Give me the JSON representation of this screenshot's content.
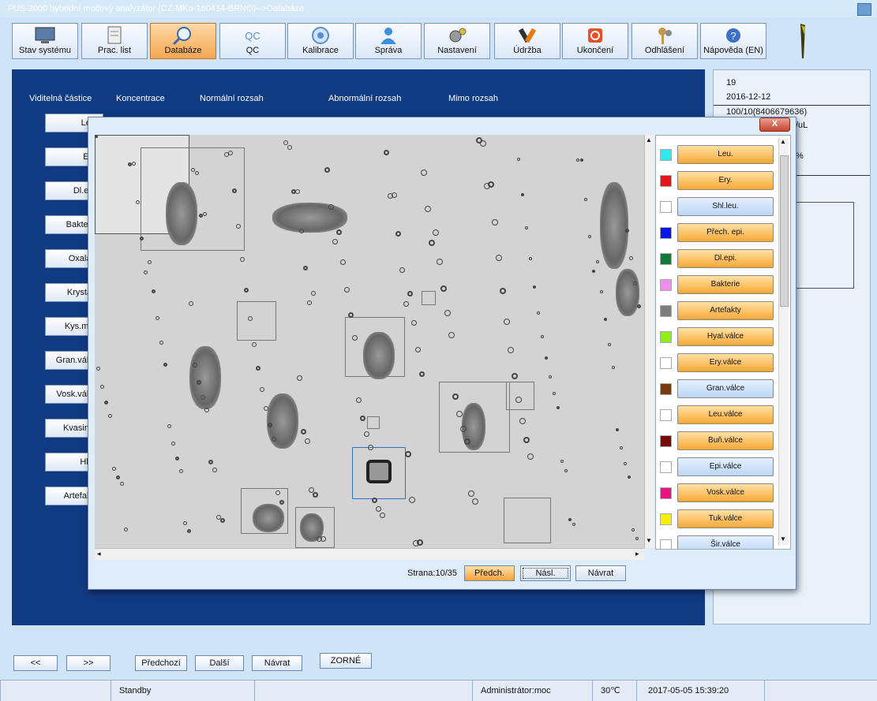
{
  "window": {
    "title": "FUS-2000 hybridní močový analyzátor (CZ-MKo-160414-BRNO)-->Databáze"
  },
  "toolbar": {
    "items": [
      {
        "label": "Stav systému",
        "icon": "monitor-icon"
      },
      {
        "label": "Prac. list",
        "icon": "worklist-icon"
      },
      {
        "label": "Databáze",
        "icon": "magnifier-icon",
        "active": true
      },
      {
        "label": "QC",
        "icon": "qc-icon",
        "icon_text": "QC"
      },
      {
        "label": "Kalibrace",
        "icon": "target-icon"
      },
      {
        "label": "Správa",
        "icon": "user-icon"
      },
      {
        "label": "Nastavení",
        "icon": "gears-icon"
      },
      {
        "label": "Údržba",
        "icon": "tools-icon"
      },
      {
        "label": "Ukončení",
        "icon": "power-icon"
      },
      {
        "label": "Odhlášení",
        "icon": "keys-icon"
      },
      {
        "label": "Nápověda (EN)",
        "icon": "help-icon"
      }
    ]
  },
  "table_headers": [
    "Viditelná částice",
    "Koncentrace",
    "Normální rozsah",
    "Abnormální rozsah",
    "Mimo rozsah"
  ],
  "particles": [
    "Leu.",
    "Ery.",
    "Dl.epi.",
    "Bakterie",
    "Oxaláty",
    "Krystaly",
    "Kys.moč",
    "Gran.válce",
    "Vosk.válce",
    "Kvasinky",
    "Hlen",
    "Artefakty"
  ],
  "right_panel": {
    "id": "19",
    "date": "2016-12-12",
    "sample": "100/10(8406679636)",
    "unit_fragment": "/uL",
    "percent_fragment": "%"
  },
  "legend": [
    {
      "label": "Leu.",
      "color": "#2ee8f0",
      "style": "or"
    },
    {
      "label": "Ery.",
      "color": "#e8141c",
      "style": "or"
    },
    {
      "label": "Shl.leu.",
      "color": "#ffffff",
      "style": "bl"
    },
    {
      "label": "Přech. epi.",
      "color": "#0a17e8",
      "style": "or"
    },
    {
      "label": "Dl.epi.",
      "color": "#117a3a",
      "style": "or"
    },
    {
      "label": "Bakterie",
      "color": "#f08ef0",
      "style": "or"
    },
    {
      "label": "Artefakty",
      "color": "#7d7d7d",
      "style": "or"
    },
    {
      "label": "Hyal.válce",
      "color": "#8ef015",
      "style": "or"
    },
    {
      "label": "Ery.válce",
      "color": "#ffffff",
      "style": "or"
    },
    {
      "label": "Gran.válce",
      "color": "#7a3a08",
      "style": "bl"
    },
    {
      "label": "Leu.válce",
      "color": "#ffffff",
      "style": "or"
    },
    {
      "label": "Buň.válce",
      "color": "#7a0a0a",
      "style": "or"
    },
    {
      "label": "Epi.válce",
      "color": "#ffffff",
      "style": "bl"
    },
    {
      "label": "Vosk.válce",
      "color": "#ea1585",
      "style": "or"
    },
    {
      "label": "Tuk.válce",
      "color": "#f5f00a",
      "style": "or"
    },
    {
      "label": "Šir.válce",
      "color": "#ffffff",
      "style": "bl"
    }
  ],
  "modal_nav": {
    "page": "Strana:10/35",
    "prev": "Předch.",
    "next": "Násl.",
    "back": "Návrat",
    "close": "X"
  },
  "bottom_nav": {
    "first": "<<",
    "last": ">>",
    "prev": "Předchozí",
    "next": "Další",
    "back": "Návrat",
    "zorne": "ZORNÉ"
  },
  "status": {
    "state": "Standby",
    "user": "Administrátor:moc",
    "temp": "30℃",
    "datetime": "2017-05-05 15:39:20"
  }
}
